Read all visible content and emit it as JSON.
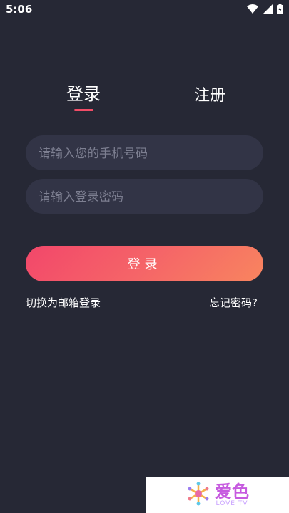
{
  "status_bar": {
    "time": "5:06"
  },
  "tabs": {
    "login": "登录",
    "register": "注册"
  },
  "form": {
    "phone_placeholder": "请输入您的手机号码",
    "password_placeholder": "请输入登录密码",
    "login_button": "登录"
  },
  "links": {
    "email_login": "切换为邮箱登录",
    "forgot_password": "忘记密码?"
  },
  "watermark": {
    "title": "爱色",
    "subtitle": "LOVE TV"
  },
  "colors": {
    "background": "#262835",
    "field": "#323446",
    "accent": "#f24d67",
    "button_gradient_start": "#f2476a",
    "button_gradient_end": "#f8855f"
  }
}
